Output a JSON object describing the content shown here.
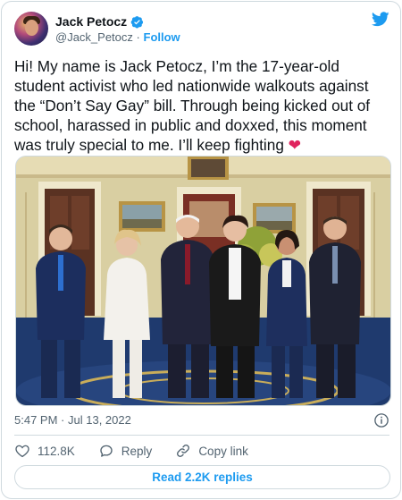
{
  "author": {
    "display_name": "Jack Petocz",
    "handle": "@Jack_Petocz",
    "separator": "·",
    "follow_label": "Follow"
  },
  "tweet": {
    "text": "Hi! My name is Jack Petocz, I’m the 17-year-old student activist who led nationwide walkouts against the “Don’t Say Gay” bill. Through being kicked out of school, harassed in public and doxxed, this moment was truly special to me. I’ll keep fighting",
    "emoji": "❤",
    "time": "5:47 PM",
    "date_separator": "·",
    "date": "Jul 13, 2022"
  },
  "actions": {
    "like_count": "112.8K",
    "reply_label": "Reply",
    "copy_link_label": "Copy link",
    "read_replies_label": "Read 2.2K replies"
  },
  "colors": {
    "accent": "#1d9bf0",
    "heart": "#e0245e",
    "text": "#0f1419",
    "muted": "#536471"
  },
  "icons": {
    "verified": "verified-badge-icon",
    "brand": "twitter-bird-icon",
    "info": "info-icon",
    "like": "heart-icon",
    "reply": "speech-bubble-icon",
    "copy_link": "link-icon"
  }
}
